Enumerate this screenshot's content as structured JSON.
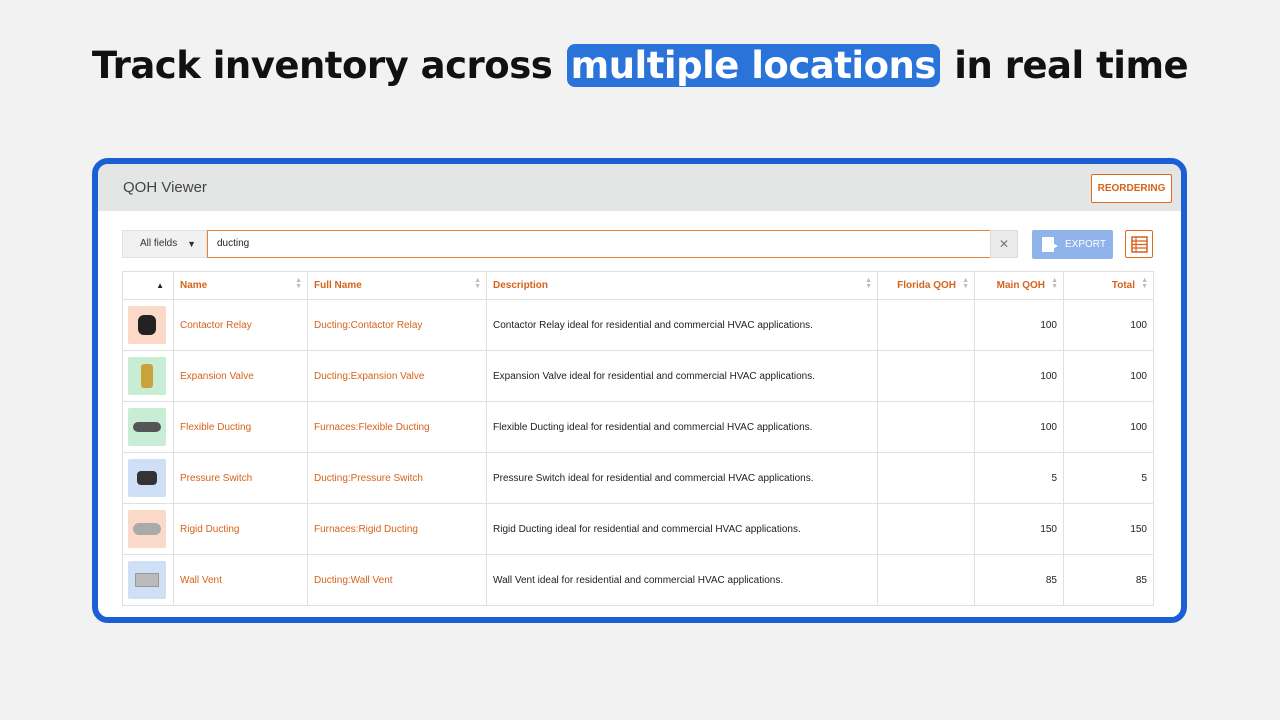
{
  "headline": {
    "before": "Track inventory across",
    "highlight": "multiple locations",
    "after": "in real time"
  },
  "panel": {
    "title": "QOH Viewer",
    "reorder_label": "REORDERING"
  },
  "toolbar": {
    "field_select": "All fields",
    "search_value": "ducting",
    "clear_label": "✕",
    "export_label": "EXPORT"
  },
  "table": {
    "columns": [
      "",
      "Name",
      "Full Name",
      "Description",
      "Florida QOH",
      "Main QOH",
      "Total"
    ],
    "rows": [
      {
        "name": "Contactor Relay",
        "full_name": "Ducting:Contactor Relay",
        "description": "Contactor Relay ideal for residential and commercial HVAC applications.",
        "florida_qoh": "",
        "main_qoh": "100",
        "total": "100",
        "thumb_bg": "#fbd9c8"
      },
      {
        "name": "Expansion Valve",
        "full_name": "Ducting:Expansion Valve",
        "description": "Expansion Valve ideal for residential and commercial HVAC applications.",
        "florida_qoh": "",
        "main_qoh": "100",
        "total": "100",
        "thumb_bg": "#c9ecd4"
      },
      {
        "name": "Flexible Ducting",
        "full_name": "Furnaces:Flexible Ducting",
        "description": "Flexible Ducting ideal for residential and commercial HVAC applications.",
        "florida_qoh": "",
        "main_qoh": "100",
        "total": "100",
        "thumb_bg": "#c9ecd4"
      },
      {
        "name": "Pressure Switch",
        "full_name": "Ducting:Pressure Switch",
        "description": "Pressure Switch ideal for residential and commercial HVAC applications.",
        "florida_qoh": "",
        "main_qoh": "5",
        "total": "5",
        "thumb_bg": "#cfe0f6"
      },
      {
        "name": "Rigid Ducting",
        "full_name": "Furnaces:Rigid Ducting",
        "description": "Rigid Ducting ideal for residential and commercial HVAC applications.",
        "florida_qoh": "",
        "main_qoh": "150",
        "total": "150",
        "thumb_bg": "#fbd9c8"
      },
      {
        "name": "Wall Vent",
        "full_name": "Ducting:Wall Vent",
        "description": "Wall Vent ideal for residential and commercial HVAC applications.",
        "florida_qoh": "",
        "main_qoh": "85",
        "total": "85",
        "thumb_bg": "#cfe0f6"
      }
    ]
  },
  "colors": {
    "accent": "#d7621a",
    "frame": "#1b5fd6",
    "highlight": "#2a73d9"
  }
}
